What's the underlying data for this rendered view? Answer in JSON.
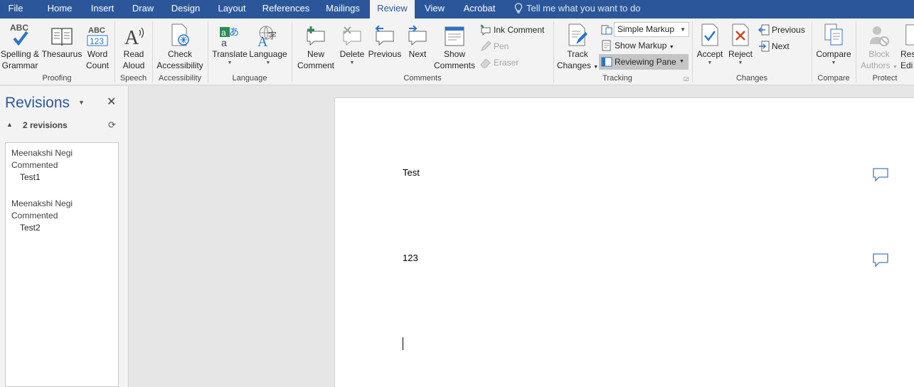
{
  "tabs": [
    "File",
    "Home",
    "Insert",
    "Draw",
    "Design",
    "Layout",
    "References",
    "Mailings",
    "Review",
    "View",
    "Acrobat"
  ],
  "active_tab": "Review",
  "tell_me": "Tell me what you want to do",
  "ribbon": {
    "proofing": {
      "label": "Proofing",
      "spelling": [
        "Spelling &",
        "Grammar"
      ],
      "thesaurus": "Thesaurus",
      "word_count": [
        "Word",
        "Count"
      ]
    },
    "speech": {
      "label": "Speech",
      "read_aloud": [
        "Read",
        "Aloud"
      ]
    },
    "accessibility": {
      "label": "Accessibility",
      "check": [
        "Check",
        "Accessibility"
      ]
    },
    "language": {
      "label": "Language",
      "translate": "Translate",
      "language": "Language"
    },
    "comments": {
      "label": "Comments",
      "new_comment": [
        "New",
        "Comment"
      ],
      "delete": "Delete",
      "previous": "Previous",
      "next": "Next",
      "show_comments": [
        "Show",
        "Comments"
      ],
      "ink_comment": "Ink Comment",
      "pen": "Pen",
      "eraser": "Eraser"
    },
    "tracking": {
      "label": "Tracking",
      "track_changes": [
        "Track",
        "Changes"
      ],
      "markup_mode": "Simple Markup",
      "show_markup": "Show Markup",
      "reviewing_pane": "Reviewing Pane"
    },
    "changes": {
      "label": "Changes",
      "accept": "Accept",
      "reject": "Reject",
      "previous": "Previous",
      "next": "Next"
    },
    "compare": {
      "label": "Compare",
      "compare": "Compare"
    },
    "protect": {
      "label": "Protect",
      "block_authors": [
        "Block",
        "Authors"
      ],
      "restrict_editing": [
        "Res",
        "Edi"
      ]
    }
  },
  "revisions_pane": {
    "title": "Revisions",
    "count": "2 revisions",
    "items": [
      {
        "author": "Meenakshi Negi",
        "action": "Commented",
        "text": "Test1"
      },
      {
        "author": "Meenakshi Negi",
        "action": "Commented",
        "text": "Test2"
      }
    ]
  },
  "document": {
    "lines": [
      "Test",
      "123"
    ]
  },
  "colors": {
    "accent": "#2b579a",
    "ribbon_bg": "#f3f3f3",
    "canvas_bg": "#e6e6e6",
    "comment_icon": "#4a7ab8"
  }
}
